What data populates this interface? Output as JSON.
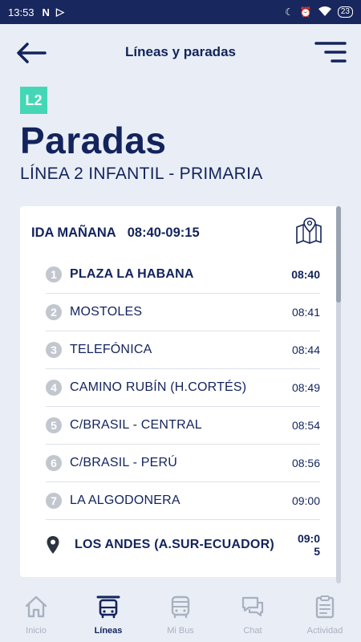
{
  "status_bar": {
    "time": "13:53",
    "battery": "23",
    "icons": [
      "n-notification-icon",
      "play-store-icon",
      "moon-icon",
      "alarm-icon",
      "wifi-icon",
      "battery-icon"
    ]
  },
  "header": {
    "title": "Líneas y paradas",
    "back_icon": "arrow-left-icon",
    "menu_icon": "menu-icon"
  },
  "line": {
    "badge": "L2",
    "badge_color": "#44d7b6",
    "heading": "Paradas",
    "name": "LÍNEA 2 INFANTIL - PRIMARIA"
  },
  "route": {
    "label": "IDA MAÑANA",
    "hours": "08:40-09:15",
    "map_icon": "map-pin-icon",
    "stops": [
      {
        "num": "1",
        "name": "PLAZA LA HABANA",
        "time": "08:40"
      },
      {
        "num": "2",
        "name": "MOSTOLES",
        "time": "08:41"
      },
      {
        "num": "3",
        "name": "TELEFÓNICA",
        "time": "08:44"
      },
      {
        "num": "4",
        "name": "CAMINO RUBÍN (H.CORTÉS)",
        "time": "08:49"
      },
      {
        "num": "5",
        "name": "C/BRASIL - CENTRAL",
        "time": "08:54"
      },
      {
        "num": "6",
        "name": "C/BRASIL - PERÚ",
        "time": "08:56"
      },
      {
        "num": "7",
        "name": "LA ALGODONERA",
        "time": "09:00"
      }
    ],
    "final_stop": {
      "name": "LOS ANDES (A.SUR-ECUADOR)",
      "time": "09:05"
    }
  },
  "nav": {
    "items": [
      {
        "label": "Inicio",
        "icon": "home-icon"
      },
      {
        "label": "Líneas",
        "icon": "bus-stop-icon"
      },
      {
        "label": "Mi Bus",
        "icon": "bus-icon"
      },
      {
        "label": "Chat",
        "icon": "chat-icon"
      },
      {
        "label": "Actividad",
        "icon": "clipboard-icon"
      }
    ],
    "active_color": "#13235c",
    "inactive_color": "#a9b1bf"
  }
}
